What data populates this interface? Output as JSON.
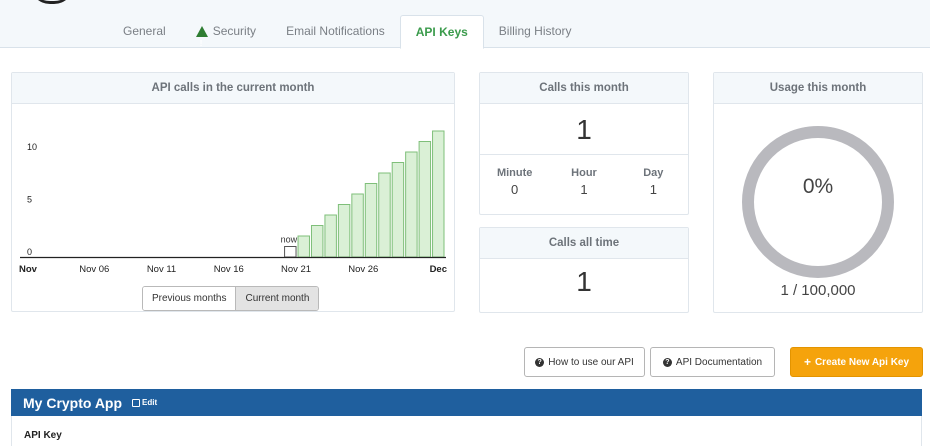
{
  "tabs": [
    {
      "label": "General"
    },
    {
      "label": "Security",
      "icon": "warning-icon"
    },
    {
      "label": "Email Notifications"
    },
    {
      "label": "API Keys",
      "active": true
    },
    {
      "label": "Billing History"
    }
  ],
  "chart_panel": {
    "title": "API calls in the current month",
    "range_buttons": [
      "Previous months",
      "Current month"
    ],
    "selected_range": "Current month"
  },
  "chart_data": {
    "type": "bar",
    "title": "API calls in the current month",
    "x": [
      21,
      22,
      23,
      24,
      25,
      26,
      27,
      28,
      29,
      30,
      31,
      32
    ],
    "values": [
      1,
      2,
      3,
      4,
      5,
      6,
      7,
      8,
      9,
      10,
      11,
      12
    ],
    "projected_from_index": 1,
    "xtick_labels": [
      "Nov",
      "Nov 06",
      "Nov 11",
      "Nov 16",
      "Nov 21",
      "Nov 26",
      "Dec"
    ],
    "xtick_values": [
      1,
      6,
      11,
      16,
      21,
      26,
      32
    ],
    "ytick_labels": [
      "0",
      "5",
      "10"
    ],
    "ytick_values": [
      0,
      5,
      10
    ],
    "ylim": [
      0,
      12
    ],
    "xlim": [
      1,
      32
    ],
    "annotation": "now",
    "colors": {
      "current": "#ffffff",
      "projected": "#daf0d6",
      "bar_stroke": "#7fbf7a",
      "current_stroke": "#555555",
      "baseline": "#222222"
    }
  },
  "calls_month": {
    "title": "Calls this month",
    "value": "1",
    "breakdown": [
      {
        "label": "Minute",
        "value": "0"
      },
      {
        "label": "Hour",
        "value": "1"
      },
      {
        "label": "Day",
        "value": "1"
      }
    ]
  },
  "calls_all_time": {
    "title": "Calls all time",
    "value": "1"
  },
  "usage": {
    "title": "Usage this month",
    "percent": "0%",
    "count": "1 / 100,000",
    "fraction": 1e-05
  },
  "actions": {
    "how_to": "How to use our API",
    "docs": "API Documentation",
    "create": "Create New Api Key"
  },
  "app": {
    "name": "My Crypto App",
    "edit": "Edit",
    "key_label": "API Key"
  }
}
